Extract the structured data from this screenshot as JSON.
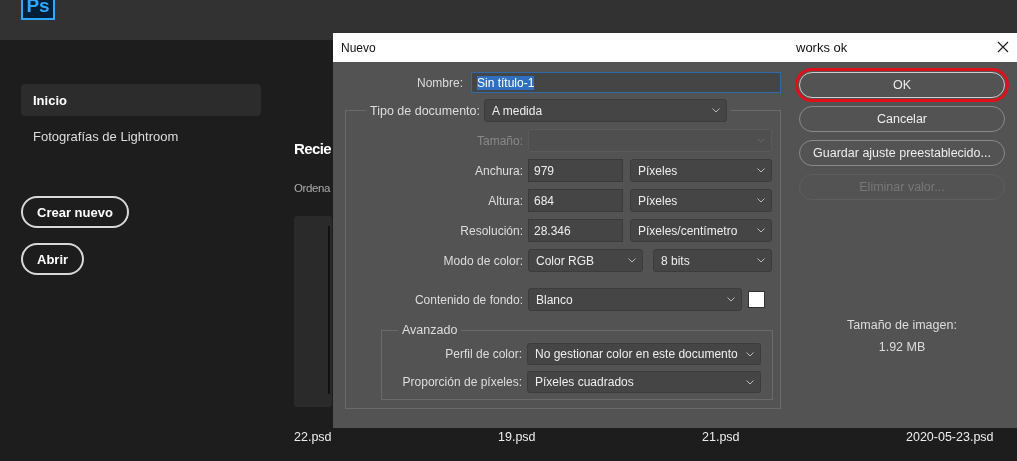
{
  "app": {
    "logo": "Ps"
  },
  "sidebar": {
    "items": [
      {
        "label": "Inicio",
        "selected": true
      },
      {
        "label": "Fotografías de Lightroom",
        "selected": false
      }
    ]
  },
  "actions": [
    "Crear nuevo",
    "Abrir"
  ],
  "recent": {
    "title": "Recie",
    "sort_label": "Ordena",
    "files": [
      "22.psd",
      "19.psd",
      "21.psd",
      "2020-05-23.psd"
    ]
  },
  "dialog": {
    "title": "Nuevo",
    "caption": "works ok",
    "name_field": {
      "label": "Nombre:",
      "value": "Sin título-1",
      "text_selected": true
    },
    "document_type": {
      "label": "Tipo de documento:",
      "value": "A medida"
    },
    "fields": [
      {
        "kind": "select",
        "label": "Tamaño:",
        "disabled": true
      },
      {
        "kind": "number",
        "label": "Anchura:",
        "value": "979",
        "unit": "Píxeles",
        "disabled": false
      },
      {
        "kind": "number",
        "label": "Altura:",
        "value": "684",
        "unit": "Píxeles",
        "disabled": false
      },
      {
        "kind": "number",
        "label": "Resolución:",
        "value": "28.346",
        "unit": "Píxeles/centímetro",
        "disabled": false
      },
      {
        "kind": "pair",
        "label": "Modo de color:",
        "value": "Color RGB",
        "unit": "8 bits",
        "disabled": false
      },
      {
        "kind": "swatch",
        "label": "Contenido de fondo:",
        "value": "Blanco",
        "disabled": false
      }
    ],
    "advanced": {
      "legend": "Avanzado",
      "fields": [
        {
          "label": "Perfil de color:",
          "value": "No gestionar color en este documento"
        },
        {
          "label": "Proporción de píxeles:",
          "value": "Píxeles cuadrados"
        }
      ]
    },
    "buttons": [
      {
        "label": "OK",
        "highlighted": true,
        "disabled": false
      },
      {
        "label": "Cancelar",
        "highlighted": false,
        "disabled": false
      },
      {
        "label": "Guardar ajuste preestablecido...",
        "highlighted": false,
        "disabled": false
      },
      {
        "label": "Eliminar valor...",
        "highlighted": false,
        "disabled": true
      }
    ],
    "image_size": {
      "label": "Tamaño de imagen:",
      "value": "1.92 MB"
    }
  }
}
